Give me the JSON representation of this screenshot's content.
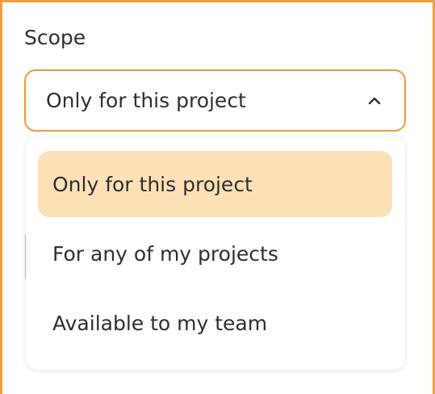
{
  "field": {
    "label": "Scope",
    "selected_value": "Only for this project",
    "chevron_icon": "chevron-up-icon"
  },
  "menu": {
    "options": [
      {
        "label": "Only for this project",
        "selected": true
      },
      {
        "label": "For any of my projects",
        "selected": false
      },
      {
        "label": "Available to my team",
        "selected": false
      }
    ]
  },
  "colors": {
    "accent_border": "#f0a041",
    "selected_option_bg": "#fde0b5",
    "text": "#2f2f2f"
  }
}
